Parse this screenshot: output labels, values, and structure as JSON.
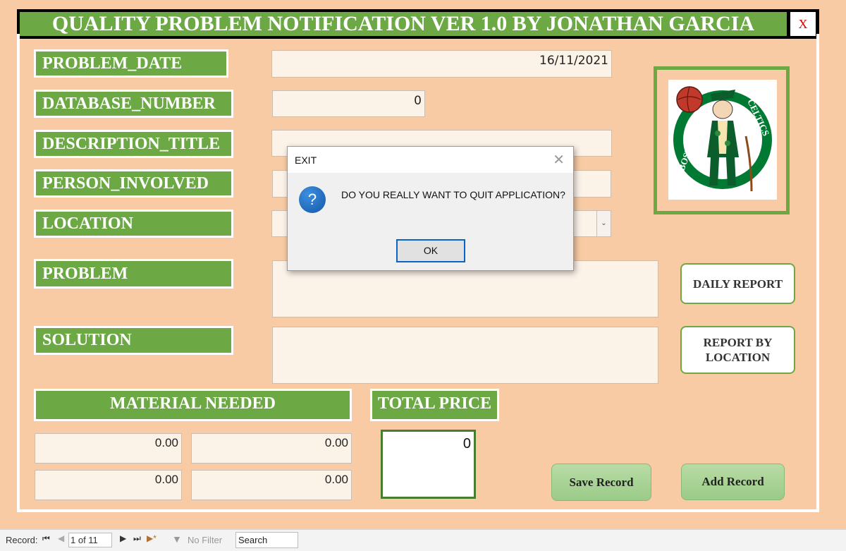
{
  "app": {
    "title": "QUALITY PROBLEM NOTIFICATION VER 1.0 BY JONATHAN GARCIA",
    "close_label": "X"
  },
  "fields": {
    "problem_date": {
      "label": "PROBLEM_DATE",
      "value": "16/11/2021"
    },
    "database_number": {
      "label": "DATABASE_NUMBER",
      "value": "0"
    },
    "description_title": {
      "label": "DESCRIPTION_TITLE",
      "value": ""
    },
    "person_involved": {
      "label": "PERSON_INVOLVED",
      "value": ""
    },
    "location": {
      "label": "LOCATION",
      "value": ""
    },
    "problem": {
      "label": "PROBLEM",
      "value": ""
    },
    "solution": {
      "label": "SOLUTION",
      "value": ""
    }
  },
  "logo": {
    "text_left": "BOSTON",
    "text_right": "CELTICS",
    "colors": {
      "green": "#007a33",
      "gold": "#ba9653",
      "ball": "#c0392b"
    }
  },
  "buttons": {
    "daily_report": "DAILY REPORT",
    "report_by_location": "REPORT BY LOCATION",
    "save_record": "Save Record",
    "add_record": "Add Record"
  },
  "material": {
    "label": "MATERIAL NEEDED",
    "values": [
      "0.00",
      "0.00",
      "0.00",
      "0.00"
    ]
  },
  "total": {
    "label": "TOTAL PRICE",
    "value": "0"
  },
  "dialog": {
    "title": "EXIT",
    "icon": "question-icon",
    "message": "DO YOU REALLY WANT TO QUIT APPLICATION?",
    "ok_label": "OK"
  },
  "statusbar": {
    "record_label": "Record:",
    "record_position": "1 of 11",
    "filter_label": "No Filter",
    "search_placeholder": "Search"
  },
  "colors": {
    "background": "#f8cba4",
    "label_green": "#6ca944",
    "field_bg": "#fbf2e8"
  }
}
